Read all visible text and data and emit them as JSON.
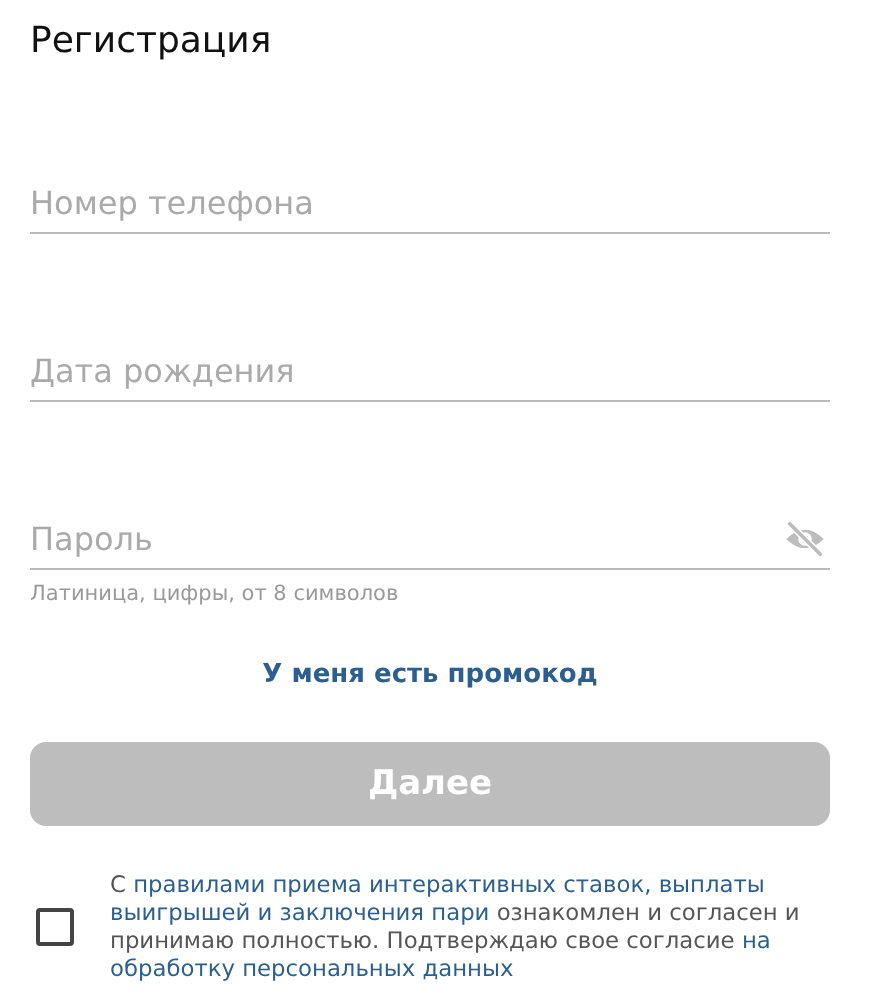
{
  "title": "Регистрация",
  "fields": [
    {
      "placeholder": "Номер телефона",
      "kind": "text"
    },
    {
      "placeholder": "Дата рождения",
      "kind": "text"
    },
    {
      "placeholder": "Пароль",
      "kind": "password",
      "hint": "Латиница, цифры, от 8 символов"
    }
  ],
  "promo_link": "У меня есть промокод",
  "submit": {
    "label": "Далее",
    "disabled": true
  },
  "consent": {
    "checked": false,
    "lines": [
      [
        {
          "text": "С ",
          "link": false
        },
        {
          "text": "правилами приема интерактивных ставок, выплаты",
          "link": true
        }
      ],
      [
        {
          "text": "выигрышей и заключения пари",
          "link": true
        },
        {
          "text": " ознакомлен и согласен и",
          "link": false
        }
      ],
      [
        {
          "text": "принимаю полностью. Подтверждаю свое согласие ",
          "link": false
        },
        {
          "text": "на",
          "link": true
        }
      ],
      [
        {
          "text": "обработку персональных данных",
          "link": true
        }
      ]
    ]
  }
}
